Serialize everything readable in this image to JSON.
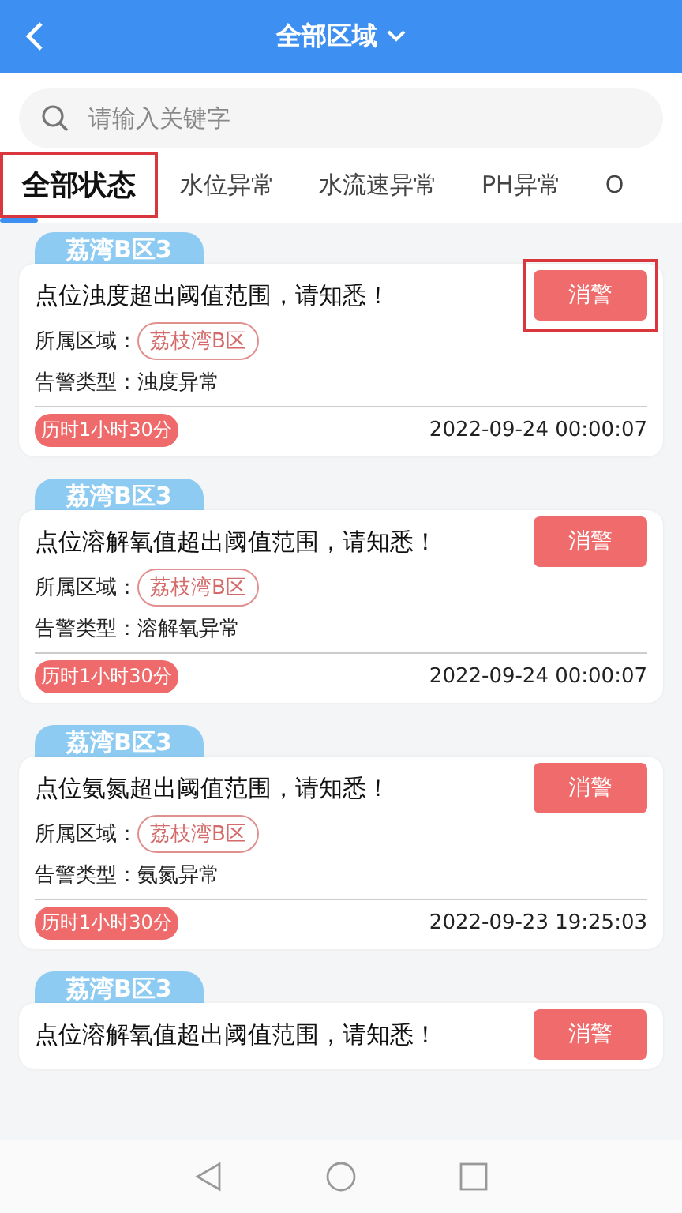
{
  "header": {
    "title": "全部区域"
  },
  "search": {
    "placeholder": "请输入关键字"
  },
  "tabs": [
    {
      "label": "全部状态",
      "selected": true,
      "highlighted": true
    },
    {
      "label": "水位异常",
      "selected": false,
      "highlighted": false
    },
    {
      "label": "水流速异常",
      "selected": false,
      "highlighted": false
    },
    {
      "label": "PH异常",
      "selected": false,
      "highlighted": false
    },
    {
      "label": "O",
      "selected": false,
      "highlighted": false
    }
  ],
  "alerts": [
    {
      "tag": "荔湾B区3",
      "title": "点位浊度超出阈值范围，请知悉！",
      "button": "消警",
      "highlighted": true,
      "region_label": "所属区域：",
      "region": "荔枝湾B区",
      "type_text": "告警类型：浊度异常",
      "duration": "历时1小时30分",
      "time": "2022-09-24 00:00:07"
    },
    {
      "tag": "荔湾B区3",
      "title": "点位溶解氧值超出阈值范围，请知悉！",
      "button": "消警",
      "highlighted": false,
      "region_label": "所属区域：",
      "region": "荔枝湾B区",
      "type_text": "告警类型：溶解氧异常",
      "duration": "历时1小时30分",
      "time": "2022-09-24 00:00:07"
    },
    {
      "tag": "荔湾B区3",
      "title": "点位氨氮超出阈值范围，请知悉！",
      "button": "消警",
      "highlighted": false,
      "region_label": "所属区域：",
      "region": "荔枝湾B区",
      "type_text": "告警类型：氨氮异常",
      "duration": "历时1小时30分",
      "time": "2022-09-23 19:25:03"
    },
    {
      "tag": "荔湾B区3",
      "title": "点位溶解氧值超出阈值范围，请知悉！",
      "button": "消警",
      "highlighted": false
    }
  ]
}
